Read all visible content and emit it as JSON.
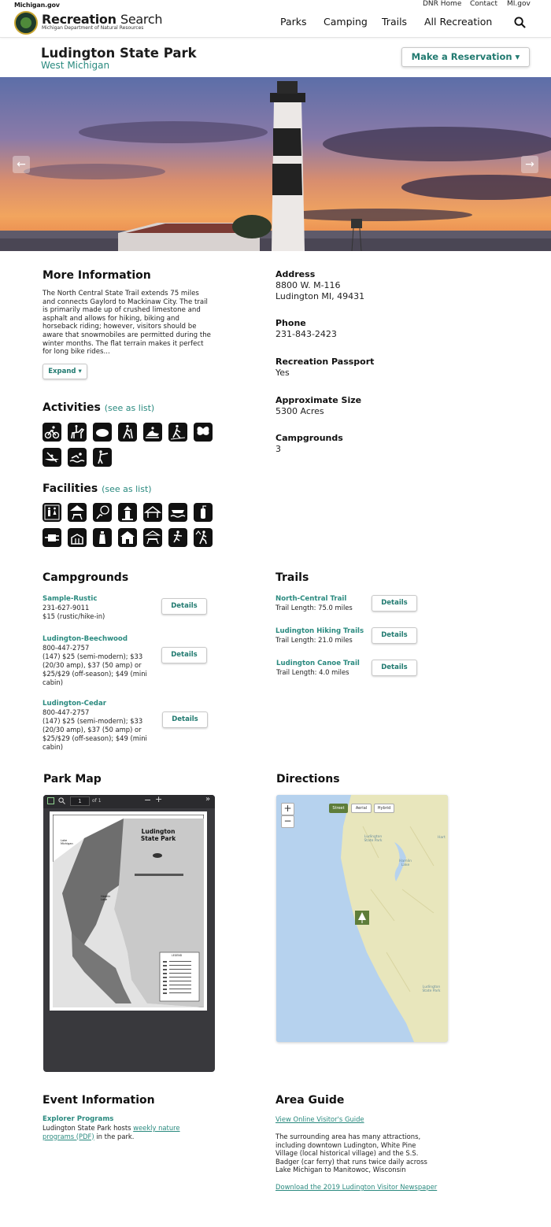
{
  "topbar": {
    "site": "Michigan.gov",
    "links": [
      "DNR Home",
      "Contact",
      "MI.gov"
    ]
  },
  "brand": {
    "title_bold": "Recreation",
    "title_light": "Search",
    "subtitle": "Michigan Department of Natural Resources"
  },
  "nav": [
    "Parks",
    "Camping",
    "Trails",
    "All Recreation"
  ],
  "park": {
    "name": "Ludington State Park",
    "region": "West Michigan",
    "reserve_label": "Make a Reservation ▾"
  },
  "more_info": {
    "heading": "More Information",
    "text": "The North Central State Trail extends 75 miles and connects Gaylord to Mackinaw City. The trail is primarily made up of crushed limestone and asphalt and allows for hiking, biking and horseback riding; however, visitors should be aware that snowmobiles are permitted during the winter months. The flat terrain makes it perfect for long bike rides...",
    "expand_label": "Expand ▾"
  },
  "details": [
    {
      "label": "Address",
      "value": "8800 W. M-116",
      "value2": "Ludington MI, 49431"
    },
    {
      "label": "Phone",
      "value": "231-843-2423"
    },
    {
      "label": "Recreation Passport",
      "value": "Yes"
    },
    {
      "label": "Approximate Size",
      "value": "5300 Acres"
    },
    {
      "label": "Campgrounds",
      "value": "3"
    }
  ],
  "activities": {
    "heading": "Activities",
    "see_list": "(see as list)",
    "icons": [
      "biking-icon",
      "horseback-riding-icon",
      "swimming-beach-icon",
      "hiking-icon",
      "snowmobiling-icon",
      "cross-country-skiing-icon",
      "butterfly-icon",
      "canoeing-icon",
      "swimming-icon",
      "hunting-icon"
    ]
  },
  "facilities": {
    "heading": "Facilities",
    "see_list": "(see as list)",
    "icons": [
      "restrooms-icon",
      "picnic-shelter-icon",
      "no-pets-icon",
      "lighthouse-icon",
      "shelter-icon",
      "boat-launch-icon",
      "fire-extinguisher-icon",
      "electric-hookup-icon",
      "fishing-pier-icon",
      "lighthouse-2-icon",
      "cabin-icon",
      "picnic-table-icon",
      "playground-icon",
      "trailhead-icon"
    ]
  },
  "campgrounds": {
    "heading": "Campgrounds",
    "details_label": "Details",
    "items": [
      {
        "name": "Sample-Rustic",
        "phone": "231-627-9011",
        "lines": [
          "$15 (rustic/hike-in)"
        ]
      },
      {
        "name": "Ludington-Beechwood",
        "phone": "800-447-2757",
        "lines": [
          "(147) $25 (semi-modern); $33",
          "(20/30 amp), $37 (50 amp) or",
          "$25/$29 (off-season); $49 (mini",
          "cabin)"
        ]
      },
      {
        "name": "Ludington-Cedar",
        "phone": "800-447-2757",
        "lines": [
          "(147) $25 (semi-modern); $33",
          "(20/30 amp), $37 (50 amp) or",
          "$25/$29 (off-season); $49 (mini",
          "cabin)"
        ]
      }
    ]
  },
  "trails": {
    "heading": "Trails",
    "details_label": "Details",
    "items": [
      {
        "name": "North-Central Trail",
        "length": "Trail Length: 75.0 miles"
      },
      {
        "name": "Ludington Hiking Trails",
        "length": "Trail Length: 21.0 miles"
      },
      {
        "name": "Ludington Canoe Trail",
        "length": "Trail Length: 4.0 miles"
      }
    ]
  },
  "park_map": {
    "heading": "Park Map",
    "page_value": "1",
    "page_of": "of 1",
    "map_title": "Ludington State Park",
    "legend_title": "LEGEND",
    "labels": [
      "Lake Michigan",
      "Hamlin Lake"
    ]
  },
  "directions": {
    "heading": "Directions",
    "tabs": [
      "Street",
      "Aerial",
      "Hybrid"
    ],
    "labels": [
      "Ludington State Park",
      "Hamlin Lake",
      "Ludington State Park",
      "Hart"
    ]
  },
  "events": {
    "heading": "Event Information",
    "program_title": "Explorer Programs",
    "text_before": "Ludington State Park hosts ",
    "link": "weekly nature programs (PDF)",
    "text_after": " in the park."
  },
  "area_guide": {
    "heading": "Area Guide",
    "link1": "View Online Visitor's Guide",
    "text": "The surrounding area has many attractions, including downtown Ludington, White Pine Village (local historical village) and the S.S. Badger (car ferry) that runs twice daily across Lake Michigan to Manitowoc, Wisconsin",
    "link2": "Download the 2019 Ludington Visitor Newspaper"
  },
  "colors": {
    "accent": "#2a8a7f",
    "pdf_bg": "#39393d",
    "map_land": "#e8e6bc",
    "map_water": "#b6d2ee"
  }
}
